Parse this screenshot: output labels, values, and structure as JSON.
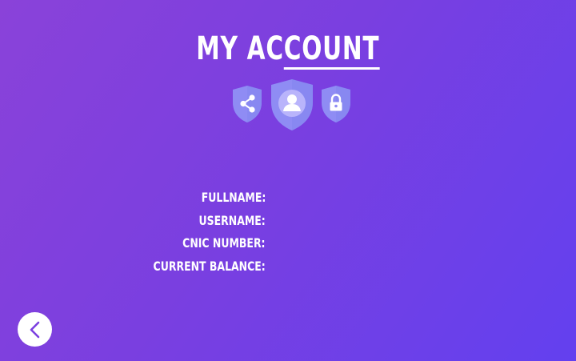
{
  "header": {
    "title_plain": "MY AC",
    "title_underlined": "COUNT"
  },
  "icons": {
    "left": "share-shield-icon",
    "center": "user-shield-icon",
    "right": "lock-shield-icon"
  },
  "account": {
    "fields": [
      {
        "label": "FULLNAME:",
        "value": ""
      },
      {
        "label": "USERNAME:",
        "value": ""
      },
      {
        "label": "CNIC NUMBER:",
        "value": ""
      },
      {
        "label": "CURRENT BALANCE:",
        "value": ""
      }
    ]
  },
  "nav": {
    "back_icon": "chevron-left-icon"
  },
  "colors": {
    "background_start": "#8a42d9",
    "background_end": "#6340ef",
    "shield": "#8f8cf4",
    "shield_light": "#b9b4fb",
    "accent": "#7b3fe0"
  }
}
